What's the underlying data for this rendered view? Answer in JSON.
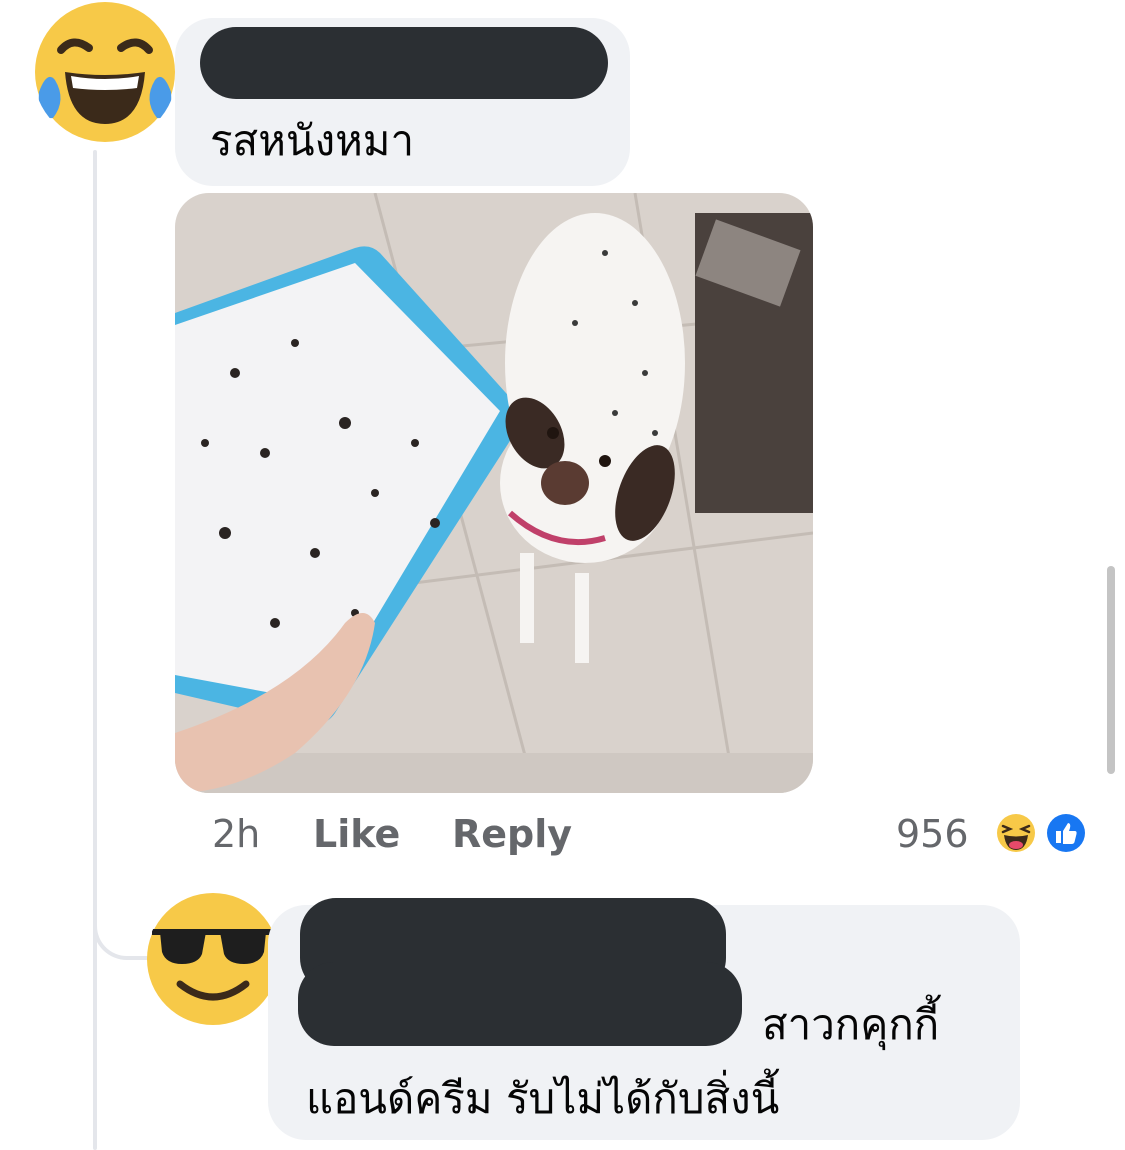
{
  "comment1": {
    "text": "รสหนังหมา",
    "time": "2h",
    "like_label": "Like",
    "reply_label": "Reply",
    "reaction_count": "956",
    "avatar_icon": "laughing-tears-emoji",
    "reaction_icons": [
      "haha-reaction-icon",
      "like-reaction-icon"
    ]
  },
  "reply1": {
    "text_line1": "สาวกคุกกี้",
    "text_line2": "แอนด์ครีม รับไม่ได้กับสิ่งนี้",
    "avatar_icon": "sunglasses-emoji"
  },
  "colors": {
    "bubble": "#f0f2f5",
    "secondary_text": "#65676b",
    "like_blue": "#1877f2",
    "emoji_yellow": "#f7c948"
  }
}
